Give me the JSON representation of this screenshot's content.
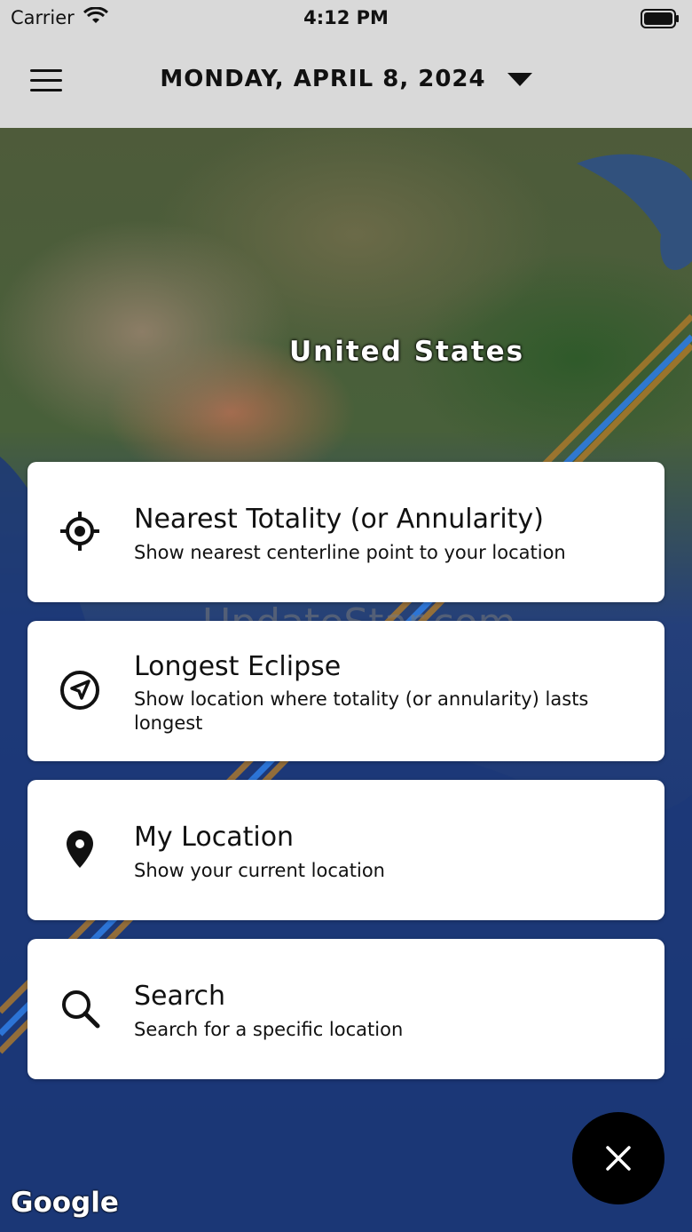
{
  "status_bar": {
    "carrier": "Carrier",
    "time": "4:12 PM"
  },
  "header": {
    "date_label": "MONDAY, APRIL 8, 2024"
  },
  "map": {
    "country_label": "United States",
    "attribution": "Google",
    "watermark": "UpdateStar.com"
  },
  "menu": [
    {
      "title": "Nearest Totality (or Annularity)",
      "subtitle": "Show nearest centerline point to your location",
      "icon": "crosshair-icon"
    },
    {
      "title": "Longest Eclipse",
      "subtitle": "Show location where totality (or annularity) lasts longest",
      "icon": "navigation-arrow-icon"
    },
    {
      "title": "My Location",
      "subtitle": "Show your current location",
      "icon": "location-pin-icon"
    },
    {
      "title": "Search",
      "subtitle": "Search for a specific location",
      "icon": "search-icon"
    }
  ],
  "colors": {
    "path_blue": "#2f7be0",
    "path_orange": "#b07a2a",
    "header_bg": "#d9d9d9"
  }
}
